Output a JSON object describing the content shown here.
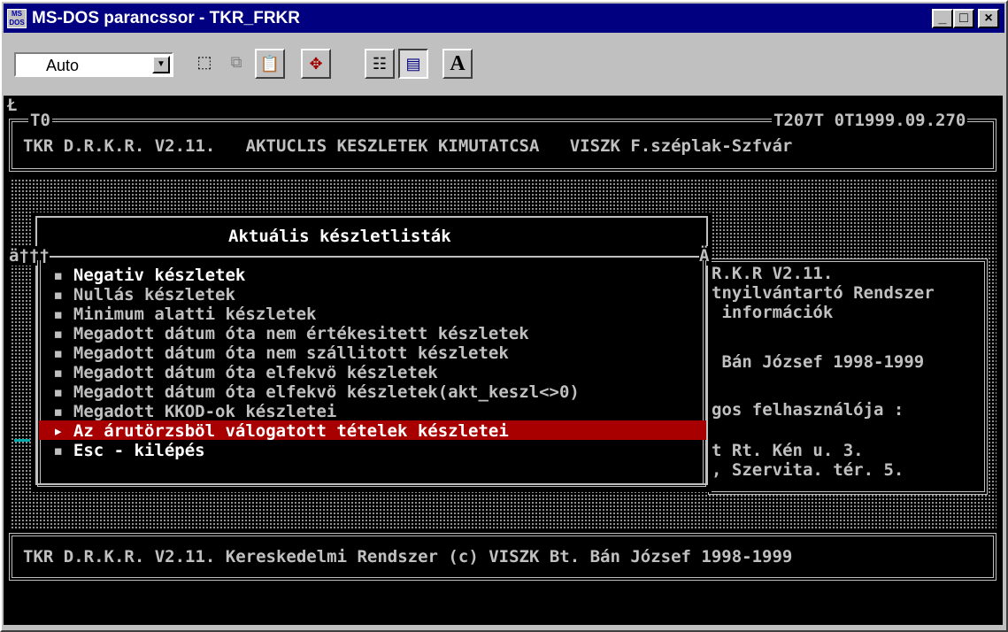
{
  "window": {
    "title": "MS-DOS parancssor - TKR_FRKR",
    "app_icon_text": "MS DOS",
    "minimize": "_",
    "maximize": "□",
    "close": "×"
  },
  "toolbar": {
    "font_size": "Auto",
    "dropdown_glyph": "▼",
    "buttons": [
      {
        "name": "mark",
        "glyph": "⬚"
      },
      {
        "name": "copy",
        "glyph": "⧉"
      },
      {
        "name": "paste",
        "glyph": "📋"
      },
      {
        "name": "fullscreen",
        "glyph": "✥"
      },
      {
        "name": "properties",
        "glyph": "☷"
      },
      {
        "name": "background",
        "glyph": "▤"
      },
      {
        "name": "font",
        "glyph": "A"
      }
    ]
  },
  "terminal": {
    "corner_glyph": "Ł",
    "header": {
      "left_tag": "T0",
      "right_tag": "T207T 0T1999.09.270",
      "text": "TKR D.R.K.R. V2.11.   AKTUCLIS KESZLETEK KIMUTATCSA   VISZK F.széplak-Szfvár"
    },
    "menu": {
      "title": "Aktuális készletlisták",
      "corner_tag": "ä†††",
      "corner_tag_right": "Ä",
      "items": [
        "Negativ készletek",
        "Nullás készletek",
        "Minimum alatti készletek",
        "Megadott dátum óta nem értékesitett készletek",
        "Megadott dátum óta nem szállitott készletek",
        "Megadott dátum óta elfekvö készletek",
        "Megadott dátum óta elfekvö készletek(akt_keszl<>0)",
        "Megadott KKOD-ok készletei",
        "Az árutörzsböl válogatott tételek készletei",
        "Esc - kilépés"
      ],
      "selected_index": 8,
      "bullet": "▪",
      "pointer": "▸"
    },
    "info_panel": {
      "lines": [
        "R.K.R V2.11.",
        "tnyilvántartó Rendszer",
        " információk",
        "",
        " Bán József 1998-1999",
        "",
        "gos felhasználója :",
        "",
        "t Rt. Kén u. 3.",
        ", Szervita. tér. 5."
      ]
    },
    "footer": "TKR D.R.K.R. V2.11. Kereskedelmi Rendszer (c) VISZK Bt. Bán József 1998-1999",
    "colors": {
      "background": "#000000",
      "text": "#c0c0c0",
      "highlight": "#ffffff",
      "selection": "#a80000",
      "cursor": "#00aaaa"
    }
  }
}
